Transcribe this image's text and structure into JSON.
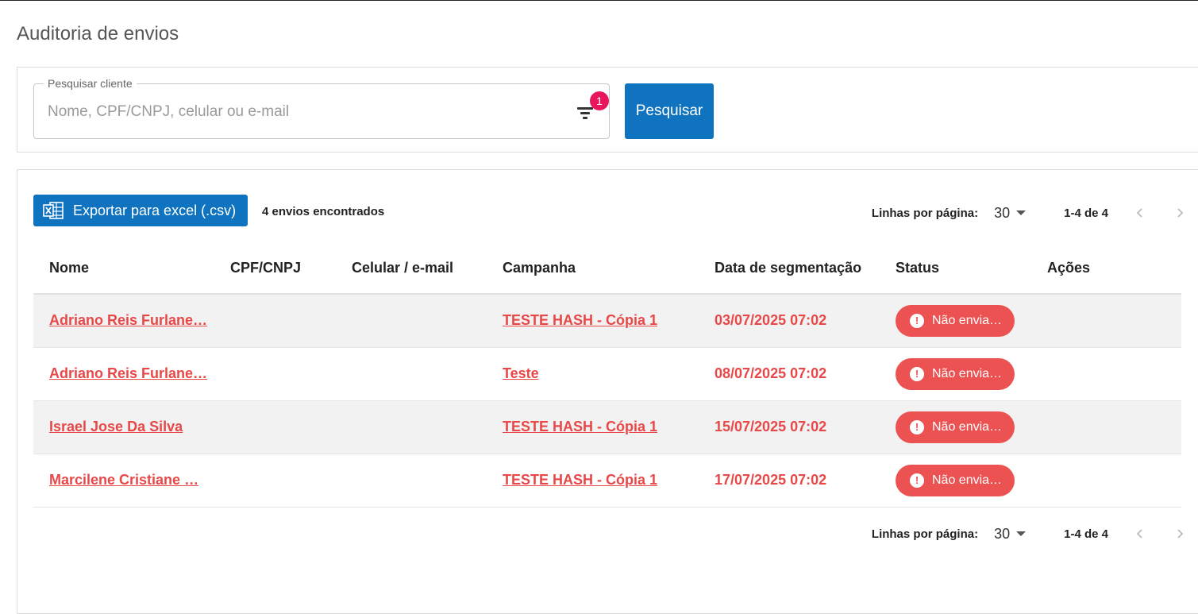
{
  "page": {
    "title": "Auditoria de envios"
  },
  "search": {
    "legend": "Pesquisar cliente",
    "placeholder": "Nome, CPF/CNPJ, celular ou e-mail",
    "filter_badge": "1",
    "button_label": "Pesquisar"
  },
  "results": {
    "export_label": "Exportar para excel (.csv)",
    "count_text": "4 envios encontrados",
    "columns": [
      "Nome",
      "CPF/CNPJ",
      "Celular / e-mail",
      "Campanha",
      "Data de segmentação",
      "Status",
      "Ações"
    ],
    "rows": [
      {
        "nome": "Adriano Reis Furlane…",
        "cpf": "",
        "contato": "",
        "campanha": "TESTE HASH - Cópia 1",
        "data": "03/07/2025 07:02",
        "status": "Não envia…"
      },
      {
        "nome": "Adriano Reis Furlane…",
        "cpf": "",
        "contato": "",
        "campanha": "Teste",
        "data": "08/07/2025 07:02",
        "status": "Não envia…"
      },
      {
        "nome": "Israel Jose Da Silva",
        "cpf": "",
        "contato": "",
        "campanha": "TESTE HASH - Cópia 1",
        "data": "15/07/2025 07:02",
        "status": "Não envia…"
      },
      {
        "nome": "Marcilene Cristiane …",
        "cpf": "",
        "contato": "",
        "campanha": "TESTE HASH - Cópia 1",
        "data": "17/07/2025 07:02",
        "status": "Não envia…"
      }
    ]
  },
  "pagination": {
    "rows_label": "Linhas por página:",
    "rows_value": "30",
    "range": "1-4 de 4"
  },
  "colors": {
    "primary": "#0f73bf",
    "status_error": "#ec5252",
    "link_red": "#e84848",
    "badge": "#e8175d"
  },
  "icons": {
    "filter": "filter-icon",
    "excel": "excel-icon",
    "alert": "alert-circle-icon",
    "prev": "chevron-left-icon",
    "next": "chevron-right-icon",
    "caret": "caret-down-icon"
  }
}
